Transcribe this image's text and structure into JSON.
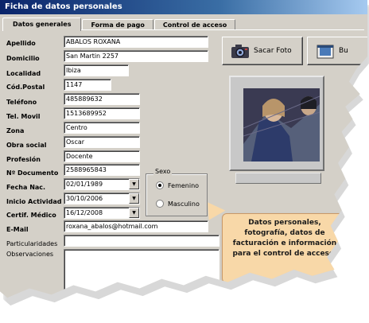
{
  "window": {
    "title": "Ficha de datos personales"
  },
  "tabs": [
    {
      "label": "Datos generales",
      "active": true
    },
    {
      "label": "Forma de pago",
      "active": false
    },
    {
      "label": "Control de acceso",
      "active": false
    }
  ],
  "form": {
    "apellido": {
      "label": "Apellido",
      "value": "ABALOS ROXANA"
    },
    "domicilio": {
      "label": "Domicilio",
      "value": "San Martin 2257"
    },
    "localidad": {
      "label": "Localidad",
      "value": "Ibiza"
    },
    "cod_postal": {
      "label": "Cód.Postal",
      "value": "1147"
    },
    "telefono": {
      "label": "Teléfono",
      "value": "485889632"
    },
    "tel_movil": {
      "label": "Tel. Movil",
      "value": "1513689952"
    },
    "zona": {
      "label": "Zona",
      "value": "Centro"
    },
    "obra_social": {
      "label": "Obra social",
      "value": "Oscar"
    },
    "profesion": {
      "label": "Profesión",
      "value": "Docente"
    },
    "nro_documento": {
      "label": "Nº Documento",
      "value": "2588965843"
    },
    "fecha_nac": {
      "label": "Fecha Nac.",
      "value": "02/01/1989"
    },
    "inicio_actividad": {
      "label": "Inicio Actividad",
      "value": "30/10/2006"
    },
    "certif_medico": {
      "label": "Certif. Médico",
      "value": "16/12/2008"
    },
    "email": {
      "label": "E-Mail",
      "value": "roxana_abalos@hotmail.com"
    },
    "particularidades": {
      "label": "Particularidades",
      "value": ""
    },
    "observaciones": {
      "label": "Observaciones",
      "value": ""
    }
  },
  "sexo": {
    "title": "Sexo",
    "options": [
      {
        "label": "Femenino",
        "checked": true
      },
      {
        "label": "Masculino",
        "checked": false
      }
    ]
  },
  "buttons": {
    "sacar_foto": "Sacar Foto",
    "second": "Bu"
  },
  "callout": {
    "text": "Datos personales, fotografía, datos de facturación e información para el control de acceso."
  },
  "icons": {
    "dropdown": "chevron-down-icon",
    "camera": "camera-icon",
    "folder": "folder-icon"
  }
}
